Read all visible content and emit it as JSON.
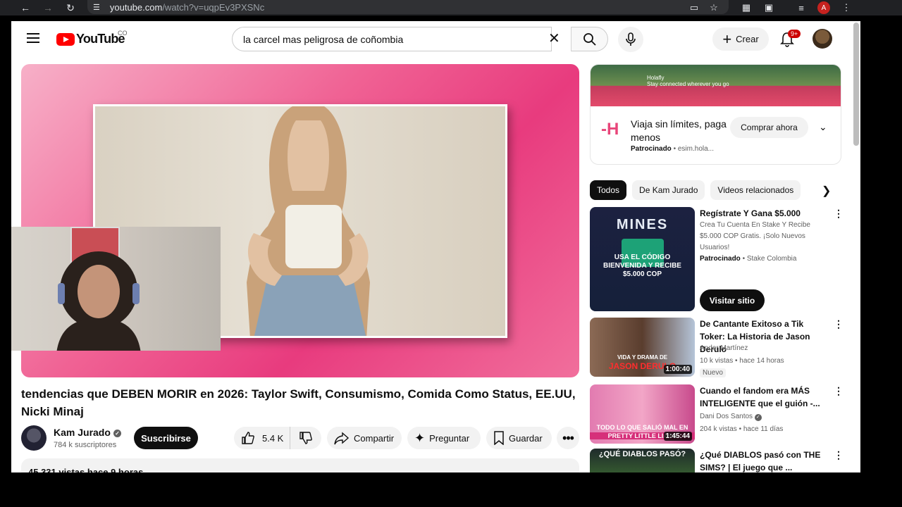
{
  "browser": {
    "url_host": "youtube.com",
    "url_path": "/watch?v=uqpEv3PXSNc",
    "profile_initial": "A"
  },
  "masthead": {
    "logo_text": "YouTube",
    "country_code": "CO",
    "search_value": "la carcel mas peligrosa de coñombia",
    "create_label": "Crear",
    "notification_count": "9+"
  },
  "video": {
    "title": "tendencias que DEBEN MORIR en 2026: Taylor Swift, Consumismo, Comida Como Status, EE.UU, Nicki Minaj",
    "channel_name": "Kam Jurado",
    "subscribers": "784 k suscriptores",
    "subscribe_label": "Suscribirse",
    "likes": "5.4 K",
    "share_label": "Compartir",
    "ask_label": "Preguntar",
    "save_label": "Guardar",
    "description_preview": "45.331 vistas  hace 9 horas"
  },
  "ad": {
    "banner_brand": "Holafly",
    "banner_tagline": "Stay connected wherever you go",
    "title": "Viaja sin límites, paga menos",
    "sponsored_label": "Patrocinado",
    "domain": "esim.hola...",
    "cta": "Comprar ahora"
  },
  "chips": [
    "Todos",
    "De Kam Jurado",
    "Videos relacionados"
  ],
  "recommendations": [
    {
      "title": "Regístrate Y Gana $5.000",
      "description": "Crea Tu Cuenta En Stake Y Recibe $5.000 COP Gratis. ¡Solo Nuevos Usuarios!",
      "sponsored_label": "Patrocinado",
      "advertiser": "Stake Colombia",
      "cta": "Visitar sitio",
      "thumb_text": "MINES",
      "thumb_sub": "USA EL CÓDIGO BIENVENIDA Y RECIBE $5.000 COP"
    },
    {
      "title": "De Cantante Exitoso a Tik Toker: La Historia de Jason Derulo",
      "channel": "Ander Martínez",
      "meta": "10 k vistas • hace 14 horas",
      "badge": "Nuevo",
      "duration": "1:00:40",
      "thumb_text": "JASON DERULO",
      "thumb_sub": "VIDA Y DRAMA DE"
    },
    {
      "title": "Cuando el fandom era MÁS INTELIGENTE que el guión -...",
      "channel": "Dani Dos Santos",
      "meta": "204 k vistas • hace 11 días",
      "duration": "1:45:44",
      "thumb_text": "TODO LO QUE SALIÓ MAL EN",
      "thumb_sub": "PRETTY LITTLE LIARS"
    },
    {
      "title": "¿Qué DIABLOS pasó con THE SIMS? | El juego que ...",
      "thumb_text": "¿QUÉ DIABLOS PASÓ?"
    }
  ]
}
